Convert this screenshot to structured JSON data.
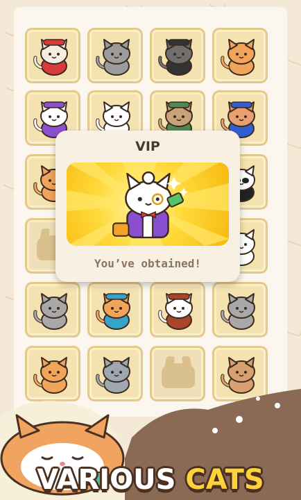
{
  "popup": {
    "title": "VIP",
    "message": "You’ve obtained!",
    "reward_icon": "vip-gentleman-cat-icon"
  },
  "collection": {
    "cells": [
      {
        "icon": "red-hood-cat-icon",
        "locked": false
      },
      {
        "icon": "grey-cat-icon",
        "locked": false
      },
      {
        "icon": "bat-mask-cat-icon",
        "locked": false
      },
      {
        "icon": "orange-tabby-cat-icon",
        "locked": false
      },
      {
        "icon": "crown-king-cat-icon",
        "locked": false
      },
      {
        "icon": "white-cat-icon",
        "locked": false
      },
      {
        "icon": "professor-cat-icon",
        "locked": false
      },
      {
        "icon": "superhero-cat-icon",
        "locked": false
      },
      {
        "icon": "orange-cat-icon",
        "locked": false
      },
      {
        "icon": "hidden-cat-icon",
        "locked": false
      },
      {
        "icon": "hidden-cat-icon",
        "locked": false
      },
      {
        "icon": "panda-cat-icon",
        "locked": false
      },
      {
        "icon": "locked-cat-silhouette-icon",
        "locked": true
      },
      {
        "icon": "hidden-cat-icon",
        "locked": false
      },
      {
        "icon": "hidden-cat-icon",
        "locked": false
      },
      {
        "icon": "white-cat-icon",
        "locked": false
      },
      {
        "icon": "grey-white-cat-icon",
        "locked": false
      },
      {
        "icon": "sunglasses-cat-icon",
        "locked": false
      },
      {
        "icon": "pirate-cat-icon",
        "locked": false
      },
      {
        "icon": "grey-white-cat-icon",
        "locked": false
      },
      {
        "icon": "orange-cat-icon",
        "locked": false
      },
      {
        "icon": "grey-tabby-cat-icon",
        "locked": false
      },
      {
        "icon": "locked-cat-silhouette-icon",
        "locked": true
      },
      {
        "icon": "brown-tabby-cat-icon",
        "locked": false
      }
    ]
  },
  "banner": {
    "word1": "VARIOUS",
    "word2": "CATS"
  },
  "colors": {
    "background": "#f3e9d6",
    "card": "#f4e3b0",
    "card_border": "#e5c98a",
    "popup": "#f7f0e3",
    "title_text": "#4a3a2e",
    "message_text": "#8a7660",
    "banner_word1": "#ffffff",
    "banner_word2": "#ffd23c"
  }
}
